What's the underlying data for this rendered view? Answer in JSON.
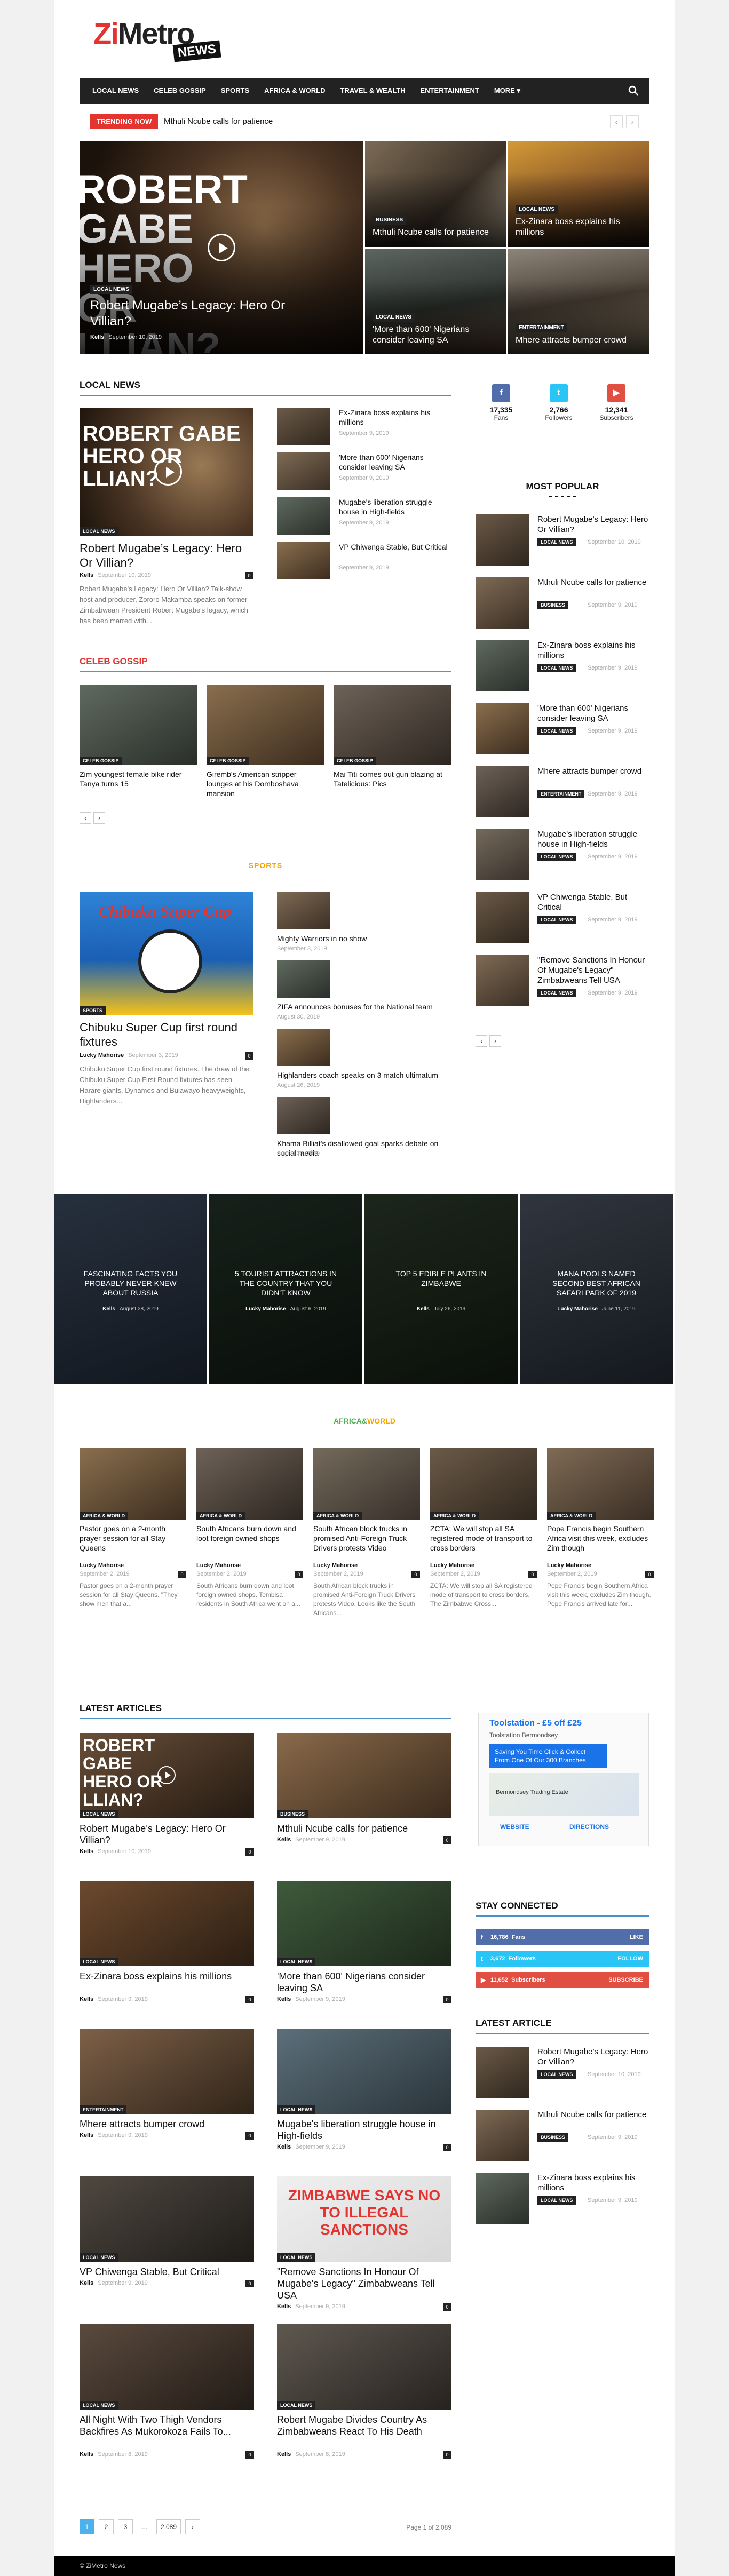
{
  "logo": {
    "zi": "Zi",
    "metro": "Metro",
    "news": "NEWS"
  },
  "menu": [
    "LOCAL NEWS",
    "CELEB GOSSIP",
    "SPORTS",
    "AFRICA & WORLD",
    "TRAVEL & WEALTH",
    "ENTERTAINMENT",
    "MORE ▾"
  ],
  "trending": {
    "tag": "TRENDING NOW",
    "text": "Mthuli Ncube calls for patience",
    "prev": "‹",
    "next": "›"
  },
  "hero": {
    "big": {
      "title": "Robert Mugabe’s Legacy: Hero Or Villian?",
      "cat": "LOCAL NEWS",
      "author": "Kells",
      "date": "September 10, 2019",
      "overlay_text": "ROBERT GABE HERO OR LLIAN?"
    },
    "tiles": [
      {
        "cat": "BUSINESS",
        "title": "Mthuli Ncube calls for patience"
      },
      {
        "cat": "LOCAL NEWS",
        "title": "Ex-Zinara boss explains his millions"
      },
      {
        "cat": "LOCAL NEWS",
        "title": "'More than 600' Nigerians consider leaving SA"
      },
      {
        "cat": "ENTERTAINMENT",
        "title": "Mhere attracts bumper crowd"
      }
    ]
  },
  "local_news": {
    "heading": "LOCAL NEWS",
    "main": {
      "cat": "LOCAL NEWS",
      "title": "Robert Mugabe’s Legacy: Hero Or Villian?",
      "author": "Kells",
      "date": "September 10, 2019",
      "comments": "0",
      "excerpt": "Robert Mugabe's Legacy: Hero Or Villian? Talk-show host and producer, Zororo Makamba speaks on former Zimbabwean President Robert Mugabe's legacy, which has been marred with..."
    },
    "list": [
      {
        "title": "Ex-Zinara boss explains his millions",
        "date": "September 9, 2019"
      },
      {
        "title": "'More than 600' Nigerians consider leaving SA",
        "date": "September 9, 2019"
      },
      {
        "title": "Mugabe's liberation struggle house in High-fields",
        "date": "September 9, 2019"
      },
      {
        "title": "VP Chiwenga Stable, But Critical",
        "date": "September 9, 2019"
      }
    ]
  },
  "celeb": {
    "heading": "CELEB GOSSIP",
    "items": [
      {
        "cat": "CELEB GOSSIP",
        "title": "Zim youngest female bike rider Tanya turns 15"
      },
      {
        "cat": "CELEB GOSSIP",
        "title": "Giremb's American stripper lounges at his Domboshava mansion"
      },
      {
        "cat": "CELEB GOSSIP",
        "title": "Mai Titi comes out gun blazing at Tatelicious: Pics"
      }
    ],
    "prev": "‹",
    "next": "›"
  },
  "sports": {
    "heading": "SPORTS",
    "main": {
      "cat": "SPORTS",
      "title": "Chibuku Super Cup first round fixtures",
      "author": "Lucky Mahorise",
      "date": "September 3, 2019",
      "comments": "0",
      "excerpt": "Chibuku Super Cup first round fixtures. The draw of the Chibuku Super Cup First Round fixtures has seen Harare giants, Dynamos and Bulawayo heavyweights, Highlanders...",
      "img_text": "Chibuku Super Cup"
    },
    "list": [
      {
        "title": "Mighty Warriors in no show",
        "date": "September 3, 2019"
      },
      {
        "title": "ZIFA announces bonuses for the National team",
        "date": "August 30, 2019"
      },
      {
        "title": "Highlanders coach speaks on 3 match ultimatum",
        "date": "August 26, 2019"
      },
      {
        "title": "Khama Billiat's disallowed goal sparks debate on social media",
        "date": "August 23, 2019"
      }
    ]
  },
  "travel": [
    {
      "title": "FASCINATING FACTS YOU PROBABLY NEVER KNEW ABOUT RUSSIA",
      "author": "Kells",
      "date": "August 28, 2019"
    },
    {
      "title": "5 TOURIST ATTRACTIONS IN THE COUNTRY THAT YOU DIDN'T KNOW",
      "author": "Lucky Mahorise",
      "date": "August 6, 2019"
    },
    {
      "title": "TOP 5 EDIBLE PLANTS IN ZIMBABWE",
      "author": "Kells",
      "date": "July 26, 2019"
    },
    {
      "title": "MANA POOLS NAMED SECOND BEST AFRICAN SAFARI PARK OF 2019",
      "author": "Lucky Mahorise",
      "date": "June 11, 2019"
    }
  ],
  "africa": {
    "heading_a": "AFRICA&",
    "heading_b": "WORLD",
    "items": [
      {
        "cat": "AFRICA & WORLD",
        "title": "Pastor goes on a 2-month prayer session for all Stay Queens",
        "author": "Lucky Mahorise",
        "date": "September 2, 2019",
        "comments": "0",
        "excerpt": "Pastor goes on a 2-month prayer session for all Stay Queens. \"They show men that a..."
      },
      {
        "cat": "AFRICA & WORLD",
        "title": "South Africans burn down and loot foreign owned shops",
        "author": "Lucky Mahorise",
        "date": "September 2, 2019",
        "comments": "0",
        "excerpt": "South Africans burn down and loot foreign owned shops. Tembisa residents in South Africa went on a..."
      },
      {
        "cat": "AFRICA & WORLD",
        "title": "South African block trucks in promised Anti-Foreign Truck Drivers protests Video",
        "author": "Lucky Mahorise",
        "date": "September 2, 2019",
        "comments": "0",
        "excerpt": "South African block trucks in promised Anti-Foreign Truck Drivers protests Video. Looks like the South Africans..."
      },
      {
        "cat": "AFRICA & WORLD",
        "title": "ZCTA: We will stop all SA registered mode of transport to cross borders",
        "author": "Lucky Mahorise",
        "date": "September 2, 2019",
        "comments": "0",
        "excerpt": "ZCTA: We will stop all SA registered mode of transport to cross borders. The Zimbabwe Cross..."
      },
      {
        "cat": "AFRICA & WORLD",
        "title": "Pope Francis begin Southern Africa visit this week, excludes Zim though",
        "author": "Lucky Mahorise",
        "date": "September 2, 2019",
        "comments": "0",
        "excerpt": "Pope Francis begin Southern Africa visit this week, excludes Zim though. Pope Francis arrived late for..."
      }
    ]
  },
  "latest": {
    "heading": "LATEST ARTICLES",
    "items": [
      {
        "cat": "LOCAL NEWS",
        "title": "Robert Mugabe’s Legacy: Hero Or Villian?",
        "author": "Kells",
        "date": "September 10, 2019",
        "comments": "0"
      },
      {
        "cat": "BUSINESS",
        "title": "Mthuli Ncube calls for patience",
        "author": "Kells",
        "date": "September 9, 2019",
        "comments": "0"
      },
      {
        "cat": "LOCAL NEWS",
        "title": "Ex-Zinara boss explains his millions",
        "author": "Kells",
        "date": "September 9, 2019",
        "comments": "0"
      },
      {
        "cat": "LOCAL NEWS",
        "title": "'More than 600' Nigerians consider leaving SA",
        "author": "Kells",
        "date": "September 9, 2019",
        "comments": "0"
      },
      {
        "cat": "Entertainment",
        "title": "Mhere attracts bumper crowd",
        "author": "Kells",
        "date": "September 9, 2019",
        "comments": "0"
      },
      {
        "cat": "LOCAL NEWS",
        "title": "Mugabe's liberation struggle house in High-fields",
        "author": "Kells",
        "date": "September 9, 2019",
        "comments": "0"
      },
      {
        "cat": "LOCAL NEWS",
        "title": "VP Chiwenga Stable, But Critical",
        "author": "Kells",
        "date": "September 9, 2019",
        "comments": "0"
      },
      {
        "cat": "LOCAL NEWS",
        "title": "\"Remove Sanctions In Honour Of Mugabe's Legacy\" Zimbabweans Tell USA",
        "author": "Kells",
        "date": "September 9, 2019",
        "comments": "0",
        "img_text": "ZIMBABWE SAYS NO TO ILLEGAL SANCTIONS"
      },
      {
        "cat": "LOCAL NEWS",
        "title": "All Night With Two Thigh Vendors Backfires As Mukorokoza Fails To...",
        "author": "Kells",
        "date": "September 8, 2019",
        "comments": "0"
      },
      {
        "cat": "LOCAL NEWS",
        "title": "Robert Mugabe Divides Country As Zimbabweans React To His Death",
        "author": "Kells",
        "date": "September 8, 2019",
        "comments": "0"
      }
    ],
    "pages": [
      "1",
      "2",
      "3",
      "...",
      "2,089",
      "›"
    ],
    "page_info": "Page 1 of 2,089"
  },
  "sidebar": {
    "social": [
      {
        "icon": "f",
        "count": "17,335",
        "label": "Fans",
        "color": "#516eab"
      },
      {
        "icon": "t",
        "count": "2,766",
        "label": "Followers",
        "color": "#29c5f6"
      },
      {
        "icon": "▶",
        "count": "12,341",
        "label": "Subscribers",
        "color": "#e14e42"
      }
    ],
    "popular_heading": "MOST POPULAR",
    "popular": [
      {
        "title": "Robert Mugabe’s Legacy: Hero Or Villian?",
        "cat": "LOCAL NEWS",
        "date": "September 10, 2019"
      },
      {
        "title": "Mthuli Ncube calls for patience",
        "cat": "BUSINESS",
        "date": "September 9, 2019"
      },
      {
        "title": "Ex-Zinara boss explains his millions",
        "cat": "LOCAL NEWS",
        "date": "September 9, 2019"
      },
      {
        "title": "'More than 600' Nigerians consider leaving SA",
        "cat": "LOCAL NEWS",
        "date": "September 9, 2019"
      },
      {
        "title": "Mhere attracts bumper crowd",
        "cat": "Entertainment",
        "date": "September 9, 2019"
      },
      {
        "title": "Mugabe's liberation struggle house in High-fields",
        "cat": "LOCAL NEWS",
        "date": "September 9, 2019"
      },
      {
        "title": "VP Chiwenga Stable, But Critical",
        "cat": "LOCAL NEWS",
        "date": "September 9, 2019"
      },
      {
        "title": "\"Remove Sanctions In Honour Of Mugabe's Legacy\" Zimbabweans Tell USA",
        "cat": "LOCAL NEWS",
        "date": "September 9, 2019"
      }
    ],
    "prev": "‹",
    "next": "›",
    "ad": {
      "title": "Toolstation - £5 off £25",
      "subtitle": "Toolstation Bermondsey",
      "button": "Saving You Time Click & Collect From One Of Our 300 Branches",
      "map_label": "Bermondsey Trading Estate",
      "website": "WEBSITE",
      "directions": "DIRECTIONS"
    },
    "connected_heading": "STAY CONNECTED",
    "connected": [
      {
        "count": "16,786",
        "label": "Fans",
        "action": "LIKE",
        "color": "#516eab"
      },
      {
        "count": "3,672",
        "label": "Followers",
        "action": "FOLLOW",
        "color": "#29c5f6"
      },
      {
        "count": "11,652",
        "label": "Subscribers",
        "action": "SUBSCRIBE",
        "color": "#e14e42"
      }
    ],
    "latest_heading": "LATEST ARTICLE",
    "latest": [
      {
        "title": "Robert Mugabe’s Legacy: Hero Or Villian?",
        "cat": "LOCAL NEWS",
        "date": "September 10, 2019"
      },
      {
        "title": "Mthuli Ncube calls for patience",
        "cat": "BUSINESS",
        "date": "September 9, 2019"
      },
      {
        "title": "Ex-Zinara boss explains his millions",
        "cat": "LOCAL NEWS",
        "date": "September 9, 2019"
      }
    ]
  },
  "footer": "© ZiMetro News"
}
